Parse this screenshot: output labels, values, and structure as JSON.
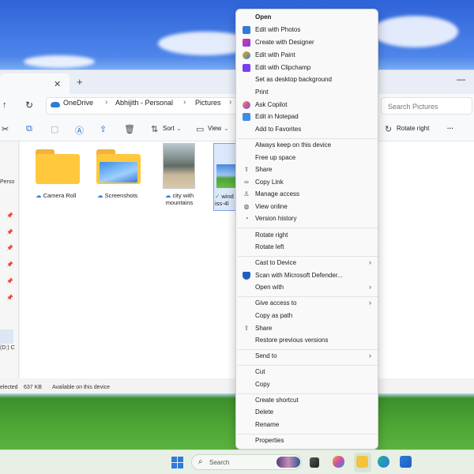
{
  "explorer": {
    "address": {
      "crumbs": [
        "OneDrive",
        "Abhijith - Personal",
        "Pictures"
      ]
    },
    "search_placeholder": "Search Pictures",
    "toolbar": {
      "sort_label": "Sort",
      "view_label": "View",
      "rotate_right_label": "Rotate right",
      "more_label": "···"
    },
    "sidebar": {
      "items": [
        "Perso",
        "(D:) C"
      ]
    },
    "items": [
      {
        "name": "Camera Roll",
        "type": "folder"
      },
      {
        "name": "Screenshots",
        "type": "folder"
      },
      {
        "name": "city with",
        "name_line2": "mountains",
        "type": "image"
      },
      {
        "name": "wind",
        "name_line2": "iss-4l",
        "type": "image",
        "selected": true
      }
    ],
    "status": {
      "selection": "elected",
      "size": "637 KB",
      "availability": "Available on this device"
    }
  },
  "context_menu": {
    "items": [
      {
        "label": "Open",
        "bold": true
      },
      {
        "label": "Edit with Photos",
        "icon": "photos-icon"
      },
      {
        "label": "Create with Designer",
        "icon": "designer-icon"
      },
      {
        "label": "Edit with Paint",
        "icon": "paint-icon"
      },
      {
        "label": "Edit with Clipchamp",
        "icon": "clipchamp-icon"
      },
      {
        "label": "Set as desktop background"
      },
      {
        "label": "Print"
      },
      {
        "label": "Ask Copilot",
        "icon": "copilot-icon"
      },
      {
        "label": "Edit in Notepad",
        "icon": "notepad-icon"
      },
      {
        "label": "Add to Favorites"
      },
      {
        "label": "Always keep on this device"
      },
      {
        "label": "Free up space"
      },
      {
        "label": "Share",
        "icon": "share-icon"
      },
      {
        "label": "Copy Link",
        "icon": "link-icon"
      },
      {
        "label": "Manage access",
        "icon": "person-icon"
      },
      {
        "label": "View online",
        "icon": "globe-icon"
      },
      {
        "label": "Version history",
        "icon": "history-icon"
      },
      {
        "label": "Rotate right"
      },
      {
        "label": "Rotate left"
      },
      {
        "label": "Cast to Device",
        "submenu": true
      },
      {
        "label": "Scan with Microsoft Defender...",
        "icon": "defender-icon"
      },
      {
        "label": "Open with",
        "submenu": true
      },
      {
        "label": "Give access to",
        "submenu": true
      },
      {
        "label": "Copy as path"
      },
      {
        "label": "Share",
        "icon": "share-icon"
      },
      {
        "label": "Restore previous versions"
      },
      {
        "label": "Send to",
        "submenu": true
      },
      {
        "label": "Cut"
      },
      {
        "label": "Copy"
      },
      {
        "label": "Create shortcut"
      },
      {
        "label": "Delete"
      },
      {
        "label": "Rename"
      },
      {
        "label": "Properties"
      }
    ]
  },
  "taskbar": {
    "search_placeholder": "Search"
  }
}
